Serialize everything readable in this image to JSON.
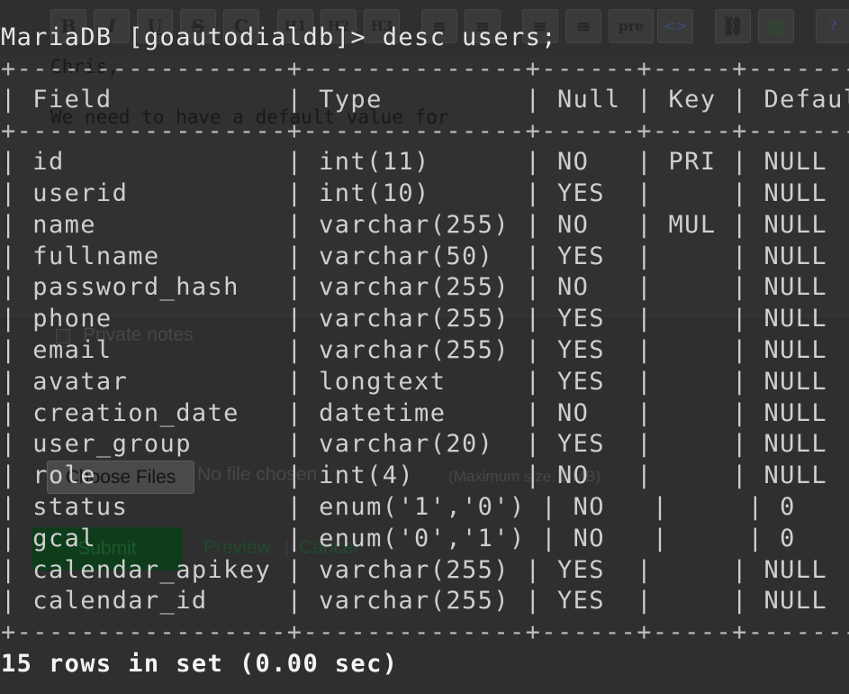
{
  "editor": {
    "toolbar": [
      {
        "label": "B",
        "icon": "bold-icon"
      },
      {
        "label": "I",
        "icon": "italic-icon"
      },
      {
        "label": "U",
        "icon": "underline-icon"
      },
      {
        "label": "S",
        "icon": "strike-icon"
      },
      {
        "label": "C",
        "icon": "code-icon"
      },
      {
        "label": "H1",
        "icon": "heading1-icon"
      },
      {
        "label": "H2",
        "icon": "heading2-icon"
      },
      {
        "label": "H3",
        "icon": "heading3-icon"
      },
      {
        "label": "≡",
        "icon": "bullet-list-icon"
      },
      {
        "label": "≡",
        "icon": "numbered-list-icon"
      },
      {
        "label": "≡",
        "icon": "indent-left-icon"
      },
      {
        "label": "≡",
        "icon": "indent-right-icon"
      },
      {
        "label": "pre",
        "icon": "preformatted-icon"
      },
      {
        "label": "<>",
        "icon": "html-icon"
      },
      {
        "label": "⛓",
        "icon": "link-icon"
      },
      {
        "label": "▦",
        "icon": "image-icon"
      },
      {
        "label": "?",
        "icon": "help-icon"
      }
    ],
    "text_line_1": "Chris,",
    "text_line_2": "We need to have a default value for",
    "private_notes_label": "Private notes",
    "choose_files_label": "Choose Files",
    "no_file_chosen": "No file chosen",
    "max_size_note": "(Maximum size: 2 MB)",
    "submit_label": "Submit",
    "preview_label": "Preview",
    "separator": "|",
    "cancel_label": "Cancel"
  },
  "terminal": {
    "prompt": "MariaDB [goautodialdb]> desc users;",
    "border": "+-----------------+--------------+------+-----+--------",
    "header": "| Field           | Type         | Null | Key | Default",
    "rows": [
      "| id              | int(11)      | NO   | PRI | NULL",
      "| userid          | int(10)      | YES  |     | NULL",
      "| name            | varchar(255) | NO   | MUL | NULL",
      "| fullname        | varchar(50)  | YES  |     | NULL",
      "| password_hash   | varchar(255) | NO   |     | NULL",
      "| phone           | varchar(255) | YES  |     | NULL",
      "| email           | varchar(255) | YES  |     | NULL",
      "| avatar          | longtext     | YES  |     | NULL",
      "| creation_date   | datetime     | NO   |     | NULL",
      "| user_group      | varchar(20)  | YES  |     | NULL",
      "| role            | int(4)       | NO   |     | NULL",
      "| status          | enum('1','0') | NO   |     | 0",
      "| gcal            | enum('0','1') | NO   |     | 0",
      "| calendar_apikey | varchar(255) | YES  |     | NULL",
      "| calendar_id     | varchar(255) | YES  |     | NULL"
    ],
    "result": "15 rows in set (0.00 sec)"
  },
  "colors": {
    "terminal_text": "#cfcfcf",
    "background": "#2c2c2c",
    "submit_button": "#0f3d1b"
  }
}
